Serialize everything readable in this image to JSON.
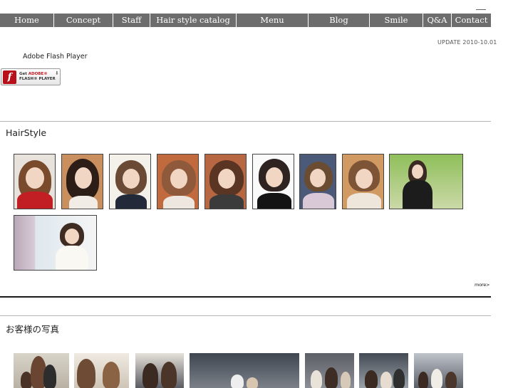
{
  "nav": {
    "items": [
      {
        "label": "Home",
        "name": "nav-home"
      },
      {
        "label": "Concept",
        "name": "nav-concept"
      },
      {
        "label": "Staff",
        "name": "nav-staff"
      },
      {
        "label": "Hair style catalog",
        "name": "nav-hair-style-catalog"
      },
      {
        "label": "Menu",
        "name": "nav-menu"
      },
      {
        "label": "Blog",
        "name": "nav-blog"
      },
      {
        "label": "Smile",
        "name": "nav-smile"
      },
      {
        "label": "Q&A",
        "name": "nav-qa"
      },
      {
        "label": "Contact",
        "name": "nav-contact"
      }
    ]
  },
  "update_text": "UPDATE 2010-10.01",
  "flash": {
    "label": "Adobe Flash Player",
    "badge_line1_prefix": "Get ",
    "badge_line1_brand": "ADOBE®",
    "badge_line2": "FLASH® PLAYER"
  },
  "hairstyle": {
    "title": "HairStyle",
    "more_label": "more>"
  },
  "customers": {
    "title": "お客様の写真"
  },
  "colors": {
    "nav_bg": "#6d6d6d",
    "flash_red": "#b8101a"
  }
}
